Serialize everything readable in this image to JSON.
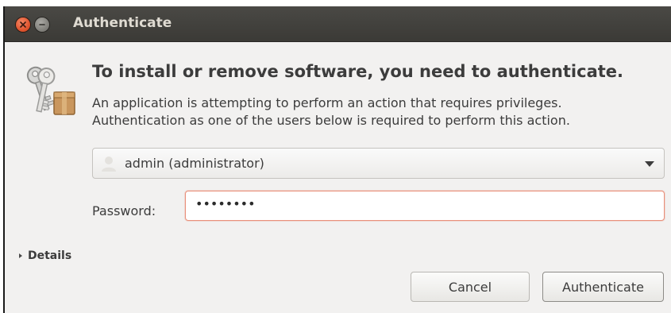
{
  "window": {
    "title": "Authenticate"
  },
  "dialog": {
    "heading": "To install or remove software, you need to authenticate.",
    "description_line1": "An application is attempting to perform an action that requires privileges.",
    "description_line2": "Authentication as one of the users below is required to perform this action.",
    "user_selected": "admin (administrator)",
    "password_label": "Password:",
    "password_value": "••••••••",
    "details_label": "Details",
    "cancel_label": "Cancel",
    "authenticate_label": "Authenticate"
  },
  "icons": {
    "close": "close-icon",
    "minimize": "minimize-icon",
    "keys": "keys-icon",
    "user": "user-avatar-icon",
    "dropdown": "chevron-down-icon",
    "details": "disclosure-arrow-icon"
  },
  "colors": {
    "titlebar": "#3c3b37",
    "close_button": "#e05a34",
    "focus_border": "#e9907a",
    "window_bg": "#f2f1f0"
  }
}
